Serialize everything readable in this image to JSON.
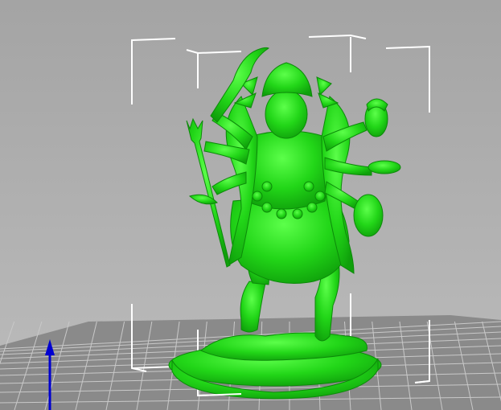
{
  "viewport": {
    "background_top": "#a9a9a9",
    "background_bottom": "#b8b8b8",
    "bed_color": "#8e8e8e",
    "bed_grid_color": "#c9c9c9",
    "model_color": "#22d618",
    "model_shadow": "#0fa00b",
    "model_highlight": "#5cff4a",
    "bbox_color": "#ffffff",
    "axis_z_color": "#0000d0",
    "axis_z_icon": "arrow-up-icon"
  }
}
